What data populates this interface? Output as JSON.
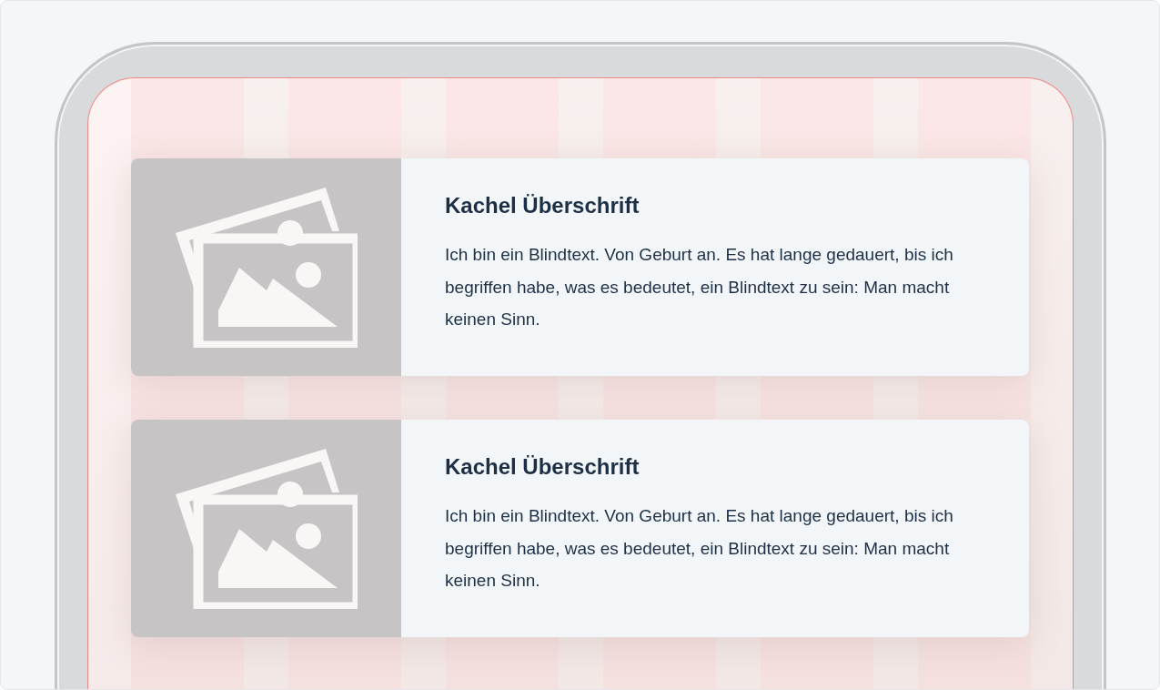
{
  "tiles": [
    {
      "title": "Kachel Überschrift",
      "text": "Ich bin ein Blindtext. Von Geburt an. Es hat lange gedauert, bis ich begriffen habe, was es bedeutet, ein Blindtext zu sein: Man macht keinen Sinn."
    },
    {
      "title": "Kachel Überschrift",
      "text": "Ich bin ein Blindtext. Von Geburt an. Es hat lange gedauert, bis ich begriffen habe, was es bedeutet, ein Blindtext zu sein: Man macht keinen Sinn."
    }
  ]
}
